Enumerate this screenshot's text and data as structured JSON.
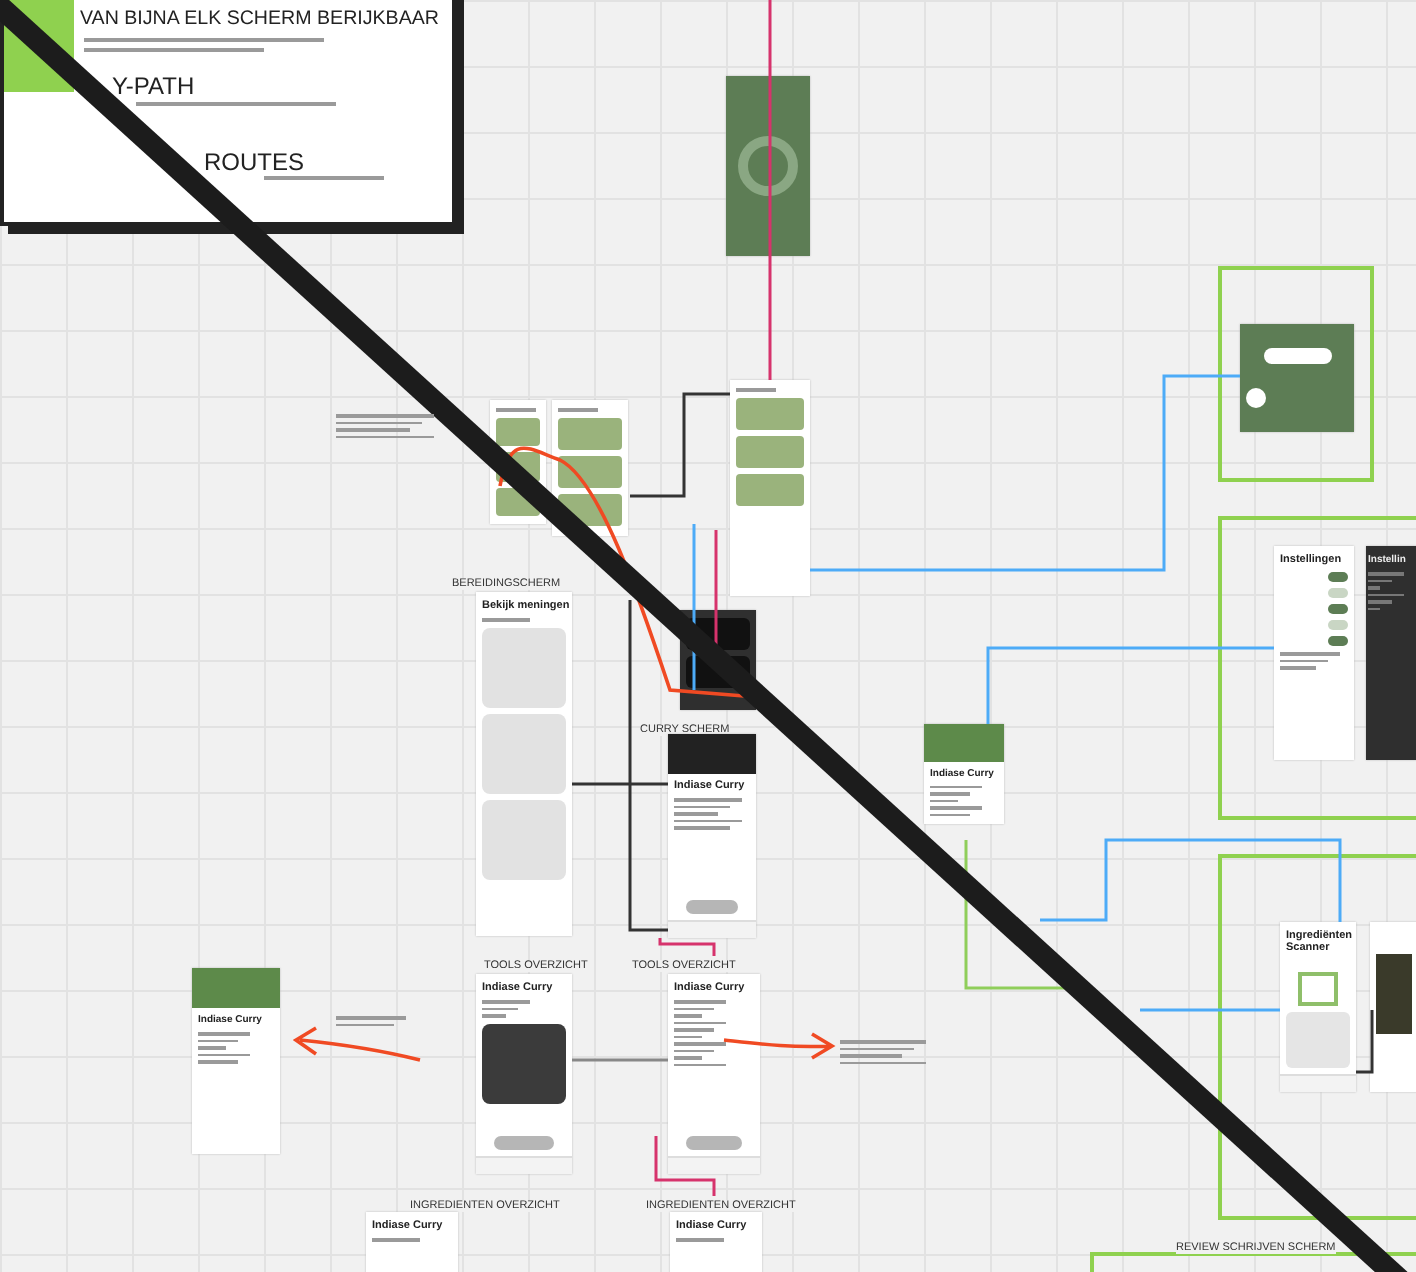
{
  "board": {
    "heading": "VAN BIJNA ELK SCHERM BERIJKBAAR",
    "sections": [
      {
        "title": "Y-PATH"
      },
      {
        "title": "ROUTES"
      }
    ]
  },
  "frame_labels": [
    "BEREIDINGSCHERM",
    "CURRY SCHERM",
    "TOOLS OVERZICHT",
    "TOOLS OVERZICHT",
    "INGREDIENTEN OVERZICHT",
    "INGREDIENTEN OVERZICHT",
    "REVIEW SCHRIJVEN SCHERM"
  ],
  "screens": [
    {
      "kind": "splash"
    },
    {
      "kind": "list"
    },
    {
      "kind": "list"
    },
    {
      "kind": "list"
    },
    {
      "kind": "dark"
    },
    {
      "kind": "reviews",
      "title": "Bekijk meningen"
    },
    {
      "kind": "curry",
      "title": "Indiase Curry"
    },
    {
      "kind": "popup",
      "title": "Indiase Curry"
    },
    {
      "kind": "tools",
      "title": "Indiase Curry"
    },
    {
      "kind": "plain",
      "title": "Indiase Curry"
    },
    {
      "kind": "plain",
      "title": "Indiase Curry"
    },
    {
      "kind": "green",
      "title": "Indiase Curry"
    },
    {
      "kind": "timer"
    },
    {
      "kind": "settings",
      "title": "Instellingen",
      "toggles": [
        {
          "on": true
        },
        {
          "on": false
        },
        {
          "on": true
        },
        {
          "on": false
        },
        {
          "on": true
        }
      ]
    },
    {
      "kind": "settings-dark",
      "title": "Instellin"
    },
    {
      "kind": "green",
      "title": "Indiase Curry"
    },
    {
      "kind": "scanner",
      "title": "Ingrediënten Scanner"
    },
    {
      "kind": "camera"
    }
  ]
}
